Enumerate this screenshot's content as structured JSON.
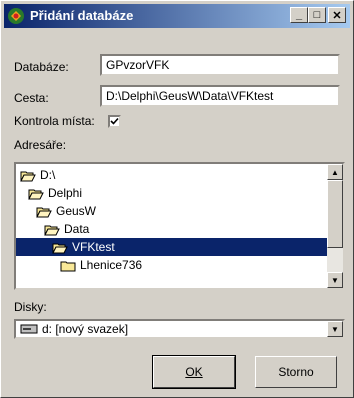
{
  "window": {
    "title": "Přidání databáze",
    "minimize": "_",
    "maximize": "□",
    "close": "✕"
  },
  "form": {
    "database_label": "Databáze:",
    "database_value": "GPvzorVFK",
    "path_label": "Cesta:",
    "path_value": "D:\\Delphi\\GeusW\\Data\\VFKtest",
    "check_label": "Kontrola místa:",
    "check_checked": true,
    "dirs_label": "Adresáře:",
    "disks_label": "Disky:"
  },
  "directories": [
    {
      "label": "D:\\",
      "level": 0,
      "selected": false
    },
    {
      "label": "Delphi",
      "level": 1,
      "selected": false
    },
    {
      "label": "GeusW",
      "level": 2,
      "selected": false
    },
    {
      "label": "Data",
      "level": 3,
      "selected": false
    },
    {
      "label": "VFKtest",
      "level": 4,
      "selected": true
    },
    {
      "label": "Lhenice736",
      "level": 5,
      "selected": false
    }
  ],
  "disk": {
    "value": "d: [nový svazek]"
  },
  "buttons": {
    "ok": "OK",
    "cancel": "Storno"
  },
  "colors": {
    "title_start": "#0a246a",
    "title_end": "#a6caf0",
    "selection": "#0a246a",
    "face": "#d4d0c8"
  }
}
